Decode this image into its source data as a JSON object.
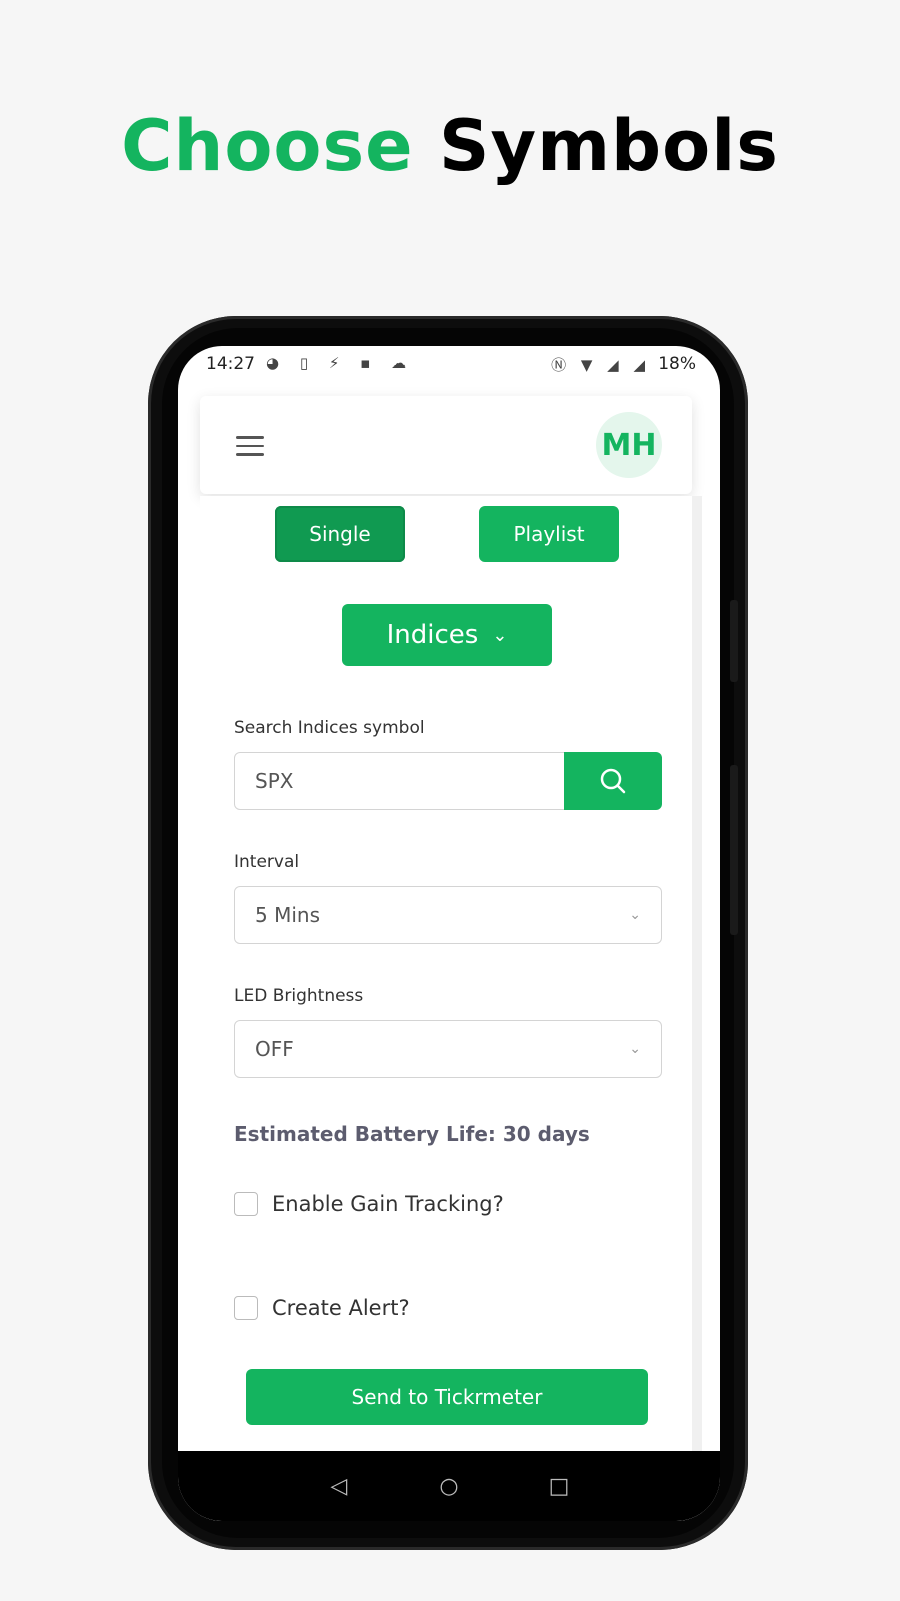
{
  "headline": {
    "accent_word": "Choose",
    "rest": "Symbols",
    "accent_color": "#14b45f"
  },
  "statusbar": {
    "time": "14:27",
    "left_icons": [
      "pinterest-icon",
      "download-icon",
      "flash-icon",
      "ifttt-icon",
      "soundcloud-icon"
    ],
    "left_glyphs": "◕ ▯ ⚡ ▪ ☁",
    "right_glyphs": "Ⓝ ▼ ◢ ◢",
    "battery": "18%"
  },
  "appbar": {
    "avatar_initials": "MH"
  },
  "mode_tabs": {
    "single": "Single",
    "playlist": "Playlist"
  },
  "category": {
    "label": "Indices",
    "chevron": "⌄"
  },
  "search": {
    "label": "Search Indices symbol",
    "value": "SPX"
  },
  "interval": {
    "label": "Interval",
    "value": "5 Mins"
  },
  "brightness": {
    "label": "LED Brightness",
    "value": "OFF"
  },
  "battery_life": "Estimated Battery Life: 30 days",
  "options": {
    "gain_tracking": "Enable Gain Tracking?",
    "create_alert": "Create Alert?"
  },
  "submit": {
    "label": "Send to Tickrmeter"
  },
  "navbar": {
    "back": "◁",
    "home": "○",
    "recents": "□"
  },
  "colors": {
    "brand_green": "#14b45f",
    "dark_green": "#109a51"
  }
}
